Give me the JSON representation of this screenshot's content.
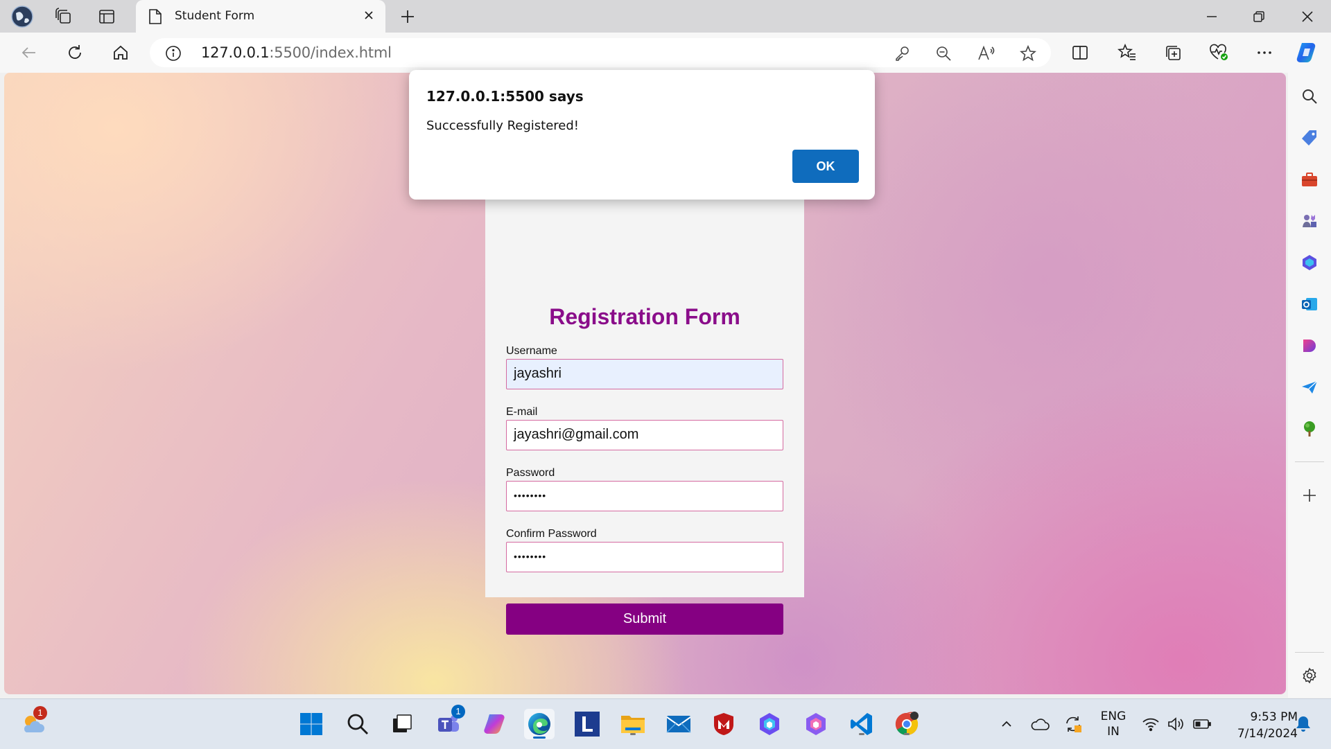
{
  "browser": {
    "tab_title": "Student Form",
    "url_host": "127.0.0.1",
    "url_rest": ":5500/index.html"
  },
  "alert": {
    "title": "127.0.0.1:5500 says",
    "message": "Successfully Registered!",
    "ok_label": "OK"
  },
  "form": {
    "title": "Registration Form",
    "username_label": "Username",
    "username_value": "jayashri",
    "email_label": "E-mail",
    "email_value": "jayashri@gmail.com",
    "password_label": "Password",
    "password_value": "••••••••",
    "confirm_label": "Confirm Password",
    "confirm_value": "••••••••",
    "submit_label": "Submit"
  },
  "taskbar": {
    "weather_badge": "1",
    "teams_badge": "1",
    "lang_line1": "ENG",
    "lang_line2": "IN",
    "time": "9:53 PM",
    "date": "7/14/2024"
  },
  "colors": {
    "form_title": "#8a0d8a",
    "submit_bg": "#850082",
    "input_border": "#d46aa0",
    "ok_button": "#0f6cbd"
  }
}
